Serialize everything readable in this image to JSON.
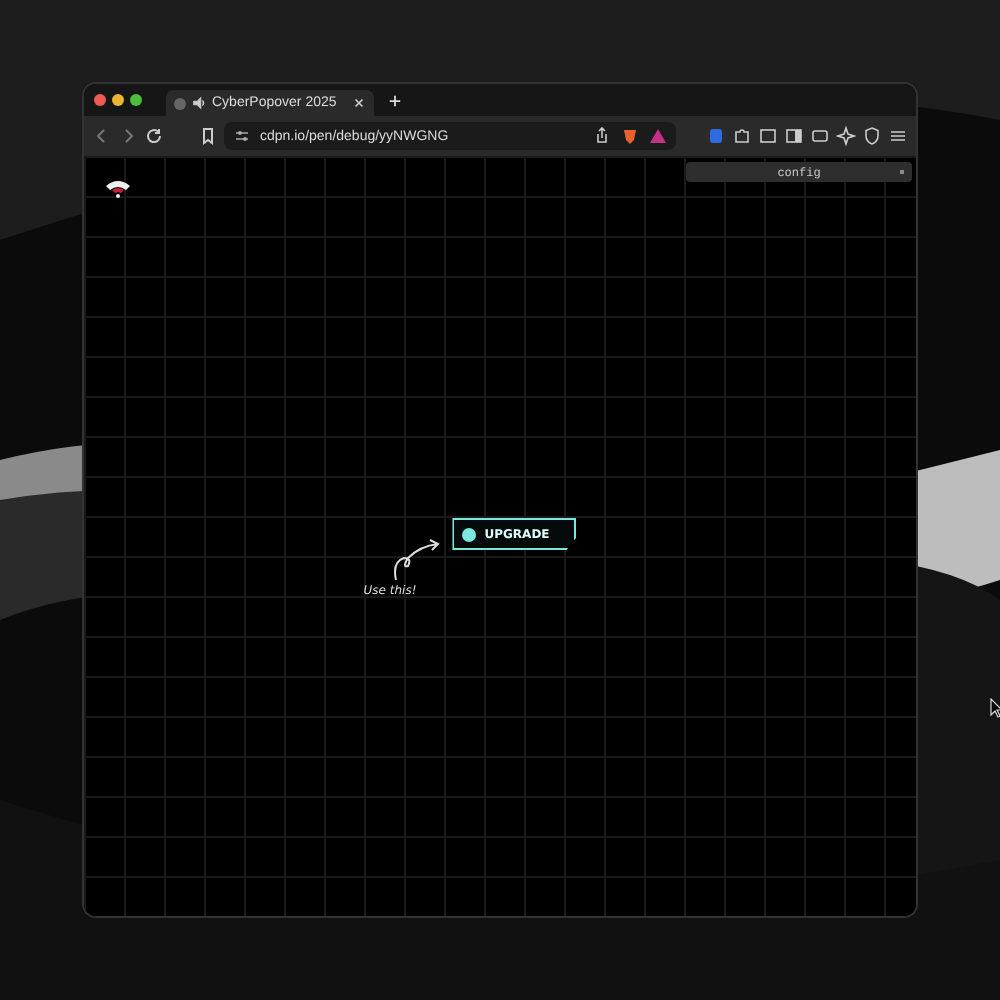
{
  "browser": {
    "tab": {
      "title": "CyberPopover 2025"
    },
    "address": "cdpn.io/pen/debug/yyNWGNG"
  },
  "page": {
    "config": {
      "label": "config"
    },
    "button": {
      "label": "UPGRADE"
    },
    "hint": "Use this!"
  }
}
